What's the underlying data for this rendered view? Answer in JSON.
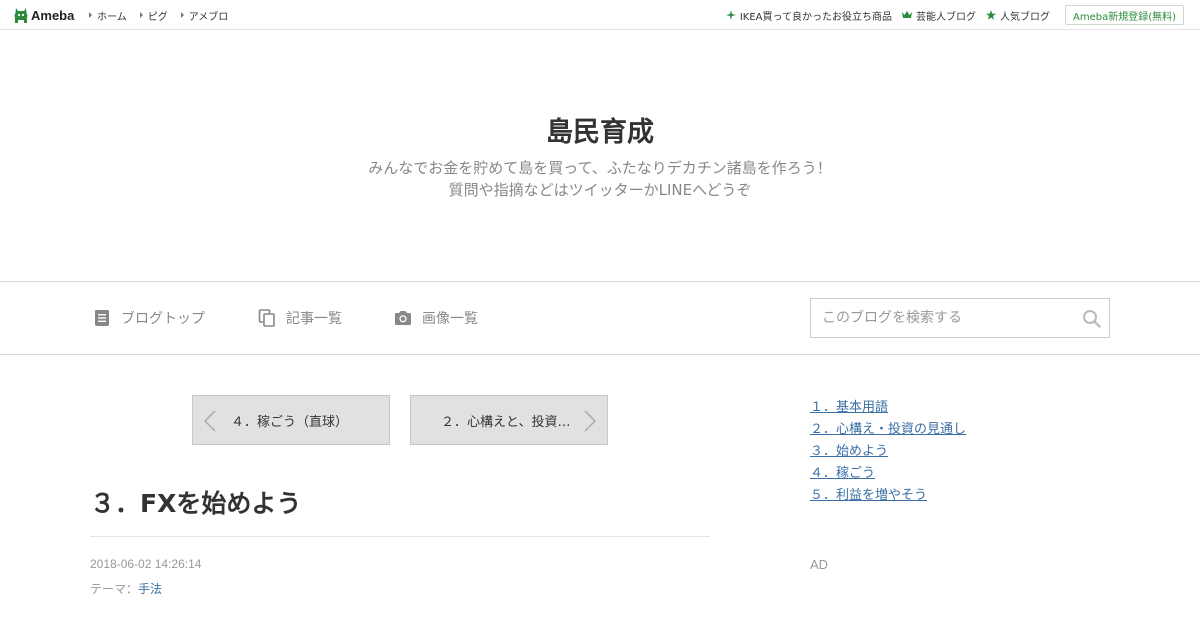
{
  "topbar": {
    "logo_text": "Ameba",
    "nav": [
      {
        "label": "ホーム"
      },
      {
        "label": "ピグ"
      },
      {
        "label": "アメブロ"
      }
    ],
    "right_links": [
      {
        "label": "IKEA買って良かったお役立ち商品",
        "icon": "sparkle-icon"
      },
      {
        "label": "芸能人ブログ",
        "icon": "crown-icon"
      },
      {
        "label": "人気ブログ",
        "icon": "star-icon"
      }
    ],
    "signup_label": "Ameba新規登録(無料)"
  },
  "blog": {
    "title": "島民育成",
    "description_line1": "みんなでお金を貯めて島を買って、ふたなりデカチン諸島を作ろう！",
    "description_line2": "質問や指摘などはツイッターかLINEへどうぞ"
  },
  "navbar": {
    "items": [
      {
        "label": "ブログトップ",
        "icon": "document-icon"
      },
      {
        "label": "記事一覧",
        "icon": "copy-icon"
      },
      {
        "label": "画像一覧",
        "icon": "camera-icon"
      }
    ],
    "search_placeholder": "このブログを検索する"
  },
  "pager": {
    "prev_label": "４．稼ごう（直球）",
    "next_label": "２．心構えと、投資…"
  },
  "article": {
    "title": "３．FXを始めよう",
    "date": "2018-06-02 14:26:14",
    "theme_prefix": "テーマ：",
    "theme_link": "手法"
  },
  "sidebar": {
    "links": [
      {
        "label": "１．基本用語"
      },
      {
        "label": "２．心構え・投資の見通し"
      },
      {
        "label": "３．始めよう"
      },
      {
        "label": "４．稼ごう"
      },
      {
        "label": "５．利益を増やそう"
      }
    ],
    "ad_label": "AD"
  },
  "colors": {
    "brand_green": "#2d8c3c",
    "link_blue": "#3a6fa5",
    "muted_gray": "#888888"
  }
}
